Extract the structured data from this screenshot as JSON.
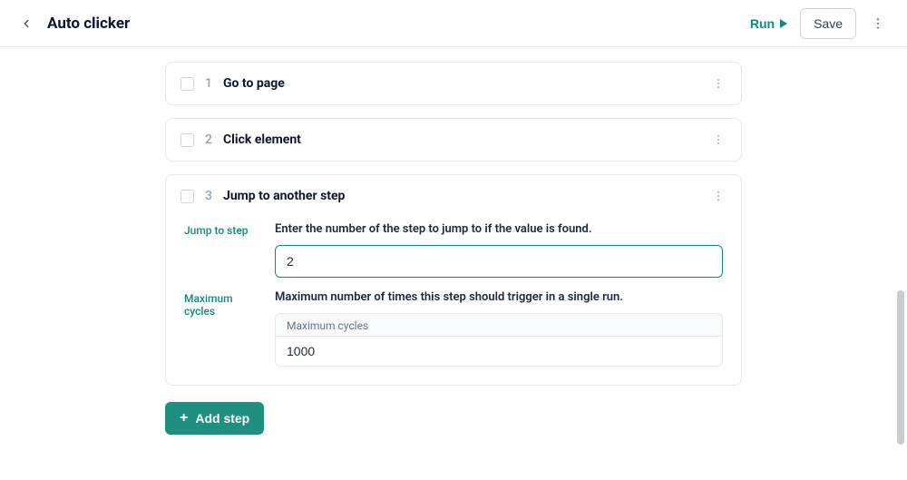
{
  "header": {
    "title": "Auto clicker",
    "run_label": "Run",
    "save_label": "Save"
  },
  "steps": [
    {
      "index": "1",
      "title": "Go to page"
    },
    {
      "index": "2",
      "title": "Click element"
    },
    {
      "index": "3",
      "title": "Jump to another step"
    }
  ],
  "jump_step": {
    "label": "Jump to step",
    "help": "Enter the number of the step to jump to if the value is found.",
    "value": "2"
  },
  "max_cycles": {
    "label": "Maximum cycles",
    "help": "Maximum number of times this step should trigger in a single run.",
    "inner_label": "Maximum cycles",
    "value": "1000"
  },
  "add_step_label": "Add step"
}
